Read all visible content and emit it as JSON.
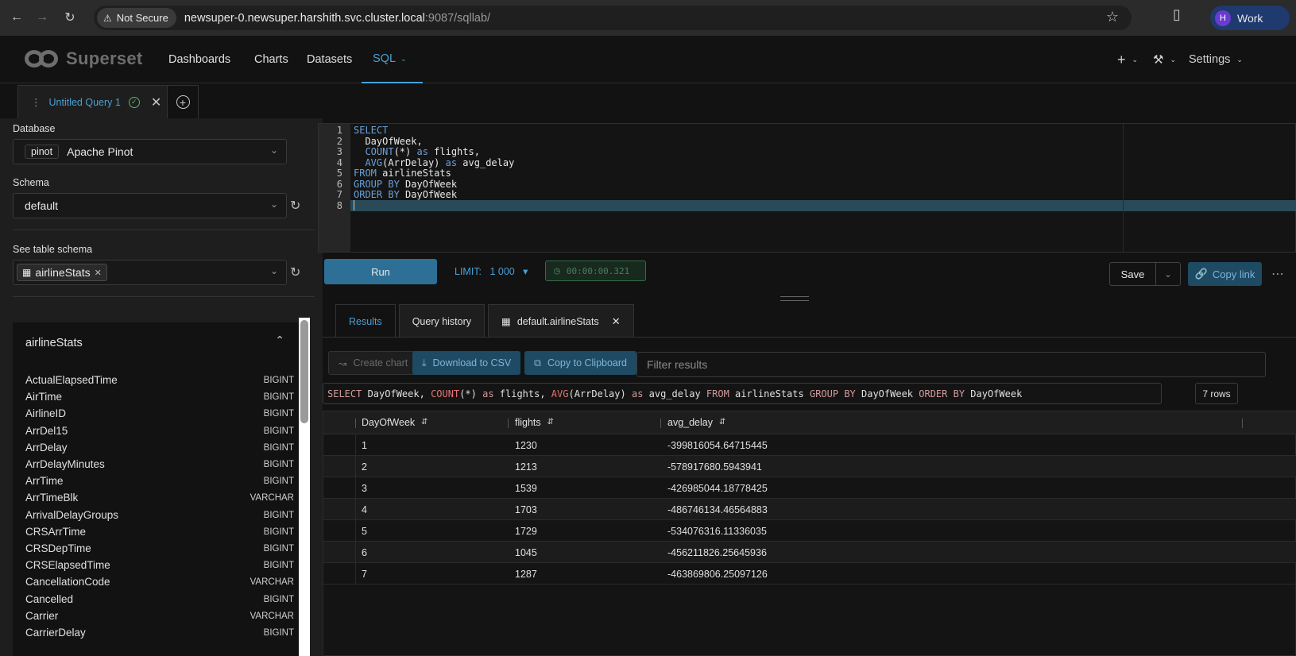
{
  "browser": {
    "security": "Not Secure",
    "url_host": "newsuper-0.newsuper.harshith.svc.cluster.local",
    "url_port_path": ":9087/sqllab/",
    "profile_initial": "H",
    "profile_name": "Work"
  },
  "app": {
    "logo_text": "Superset",
    "menu": [
      "Dashboards",
      "Charts",
      "Datasets",
      "SQL"
    ],
    "settings_label": "Settings"
  },
  "query_tab": {
    "title": "Untitled Query 1"
  },
  "left_panel": {
    "database_label": "Database",
    "database_engine": "pinot",
    "database_name": "Apache Pinot",
    "schema_label": "Schema",
    "schema_value": "default",
    "table_schema_label": "See table schema",
    "selected_table": "airlineStats",
    "table_card_title": "airlineStats",
    "columns": [
      {
        "name": "ActualElapsedTime",
        "type": "BIGINT"
      },
      {
        "name": "AirTime",
        "type": "BIGINT"
      },
      {
        "name": "AirlineID",
        "type": "BIGINT"
      },
      {
        "name": "ArrDel15",
        "type": "BIGINT"
      },
      {
        "name": "ArrDelay",
        "type": "BIGINT"
      },
      {
        "name": "ArrDelayMinutes",
        "type": "BIGINT"
      },
      {
        "name": "ArrTime",
        "type": "BIGINT"
      },
      {
        "name": "ArrTimeBlk",
        "type": "VARCHAR"
      },
      {
        "name": "ArrivalDelayGroups",
        "type": "BIGINT"
      },
      {
        "name": "CRSArrTime",
        "type": "BIGINT"
      },
      {
        "name": "CRSDepTime",
        "type": "BIGINT"
      },
      {
        "name": "CRSElapsedTime",
        "type": "BIGINT"
      },
      {
        "name": "CancellationCode",
        "type": "VARCHAR"
      },
      {
        "name": "Cancelled",
        "type": "BIGINT"
      },
      {
        "name": "Carrier",
        "type": "VARCHAR"
      },
      {
        "name": "CarrierDelay",
        "type": "BIGINT"
      }
    ]
  },
  "editor": {
    "lines": [
      "SELECT",
      "  DayOfWeek,",
      "  COUNT(*) as flights,",
      "  AVG(ArrDelay) as avg_delay",
      "FROM airlineStats",
      "GROUP BY DayOfWeek",
      "ORDER BY DayOfWeek",
      ""
    ]
  },
  "toolbar": {
    "run_label": "Run",
    "limit_label": "LIMIT:",
    "limit_value": "1 000",
    "timer": "00:00:00.321",
    "save_label": "Save",
    "copy_link_label": "Copy link"
  },
  "results": {
    "tabs": [
      "Results",
      "Query history",
      "default.airlineStats"
    ],
    "create_chart_label": "Create chart",
    "download_csv_label": "Download to CSV",
    "copy_clipboard_label": "Copy to Clipboard",
    "filter_placeholder": "Filter results",
    "executed_sql": "SELECT DayOfWeek, COUNT(*) as flights, AVG(ArrDelay) as avg_delay FROM airlineStats GROUP BY DayOfWeek ORDER BY DayOfWeek",
    "row_count": "7 rows",
    "columns": [
      "DayOfWeek",
      "flights",
      "avg_delay"
    ],
    "rows": [
      [
        "1",
        "1230",
        "-399816054.64715445"
      ],
      [
        "2",
        "1213",
        "-578917680.5943941"
      ],
      [
        "3",
        "1539",
        "-426985044.18778425"
      ],
      [
        "4",
        "1703",
        "-486746134.46564883"
      ],
      [
        "5",
        "1729",
        "-534076316.11336035"
      ],
      [
        "6",
        "1045",
        "-456211826.25645936"
      ],
      [
        "7",
        "1287",
        "-463869806.25097126"
      ]
    ]
  }
}
